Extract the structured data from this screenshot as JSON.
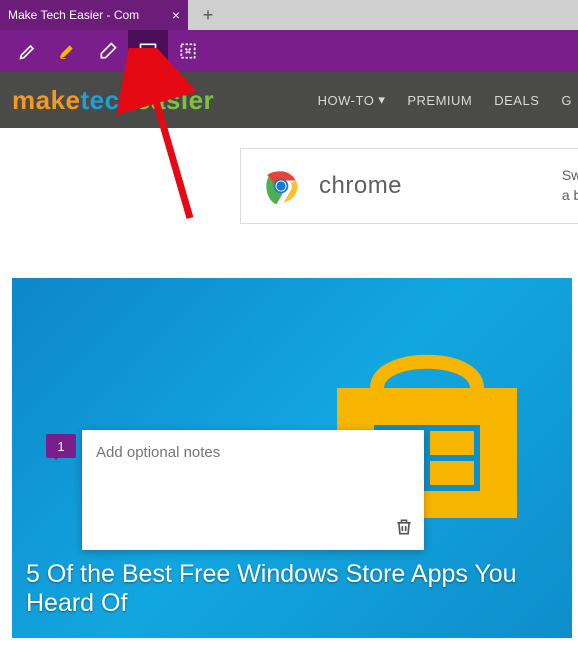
{
  "browser": {
    "tab_title": "Make Tech Easier - Com",
    "new_tab_symbol": "+"
  },
  "annot_toolbar": {
    "icons": [
      "pen-icon",
      "highlighter-icon",
      "eraser-icon",
      "note-icon",
      "clip-icon"
    ],
    "active_index": 3
  },
  "site": {
    "logo": {
      "seg1": "make",
      "seg2": "tech",
      "seg3": "easier"
    },
    "nav": [
      {
        "label": "HOW-TO",
        "dropdown": true
      },
      {
        "label": "PREMIUM",
        "dropdown": false
      },
      {
        "label": "DEALS",
        "dropdown": false
      },
      {
        "label": "G",
        "dropdown": false
      }
    ]
  },
  "ad": {
    "brand": "chrome",
    "line1": "Switch to",
    "line2": "a better b"
  },
  "hero": {
    "headline": "5 Of the Best Free Windows Store Apps You Heard Of"
  },
  "note": {
    "badge": "1",
    "placeholder": "Add optional notes"
  }
}
